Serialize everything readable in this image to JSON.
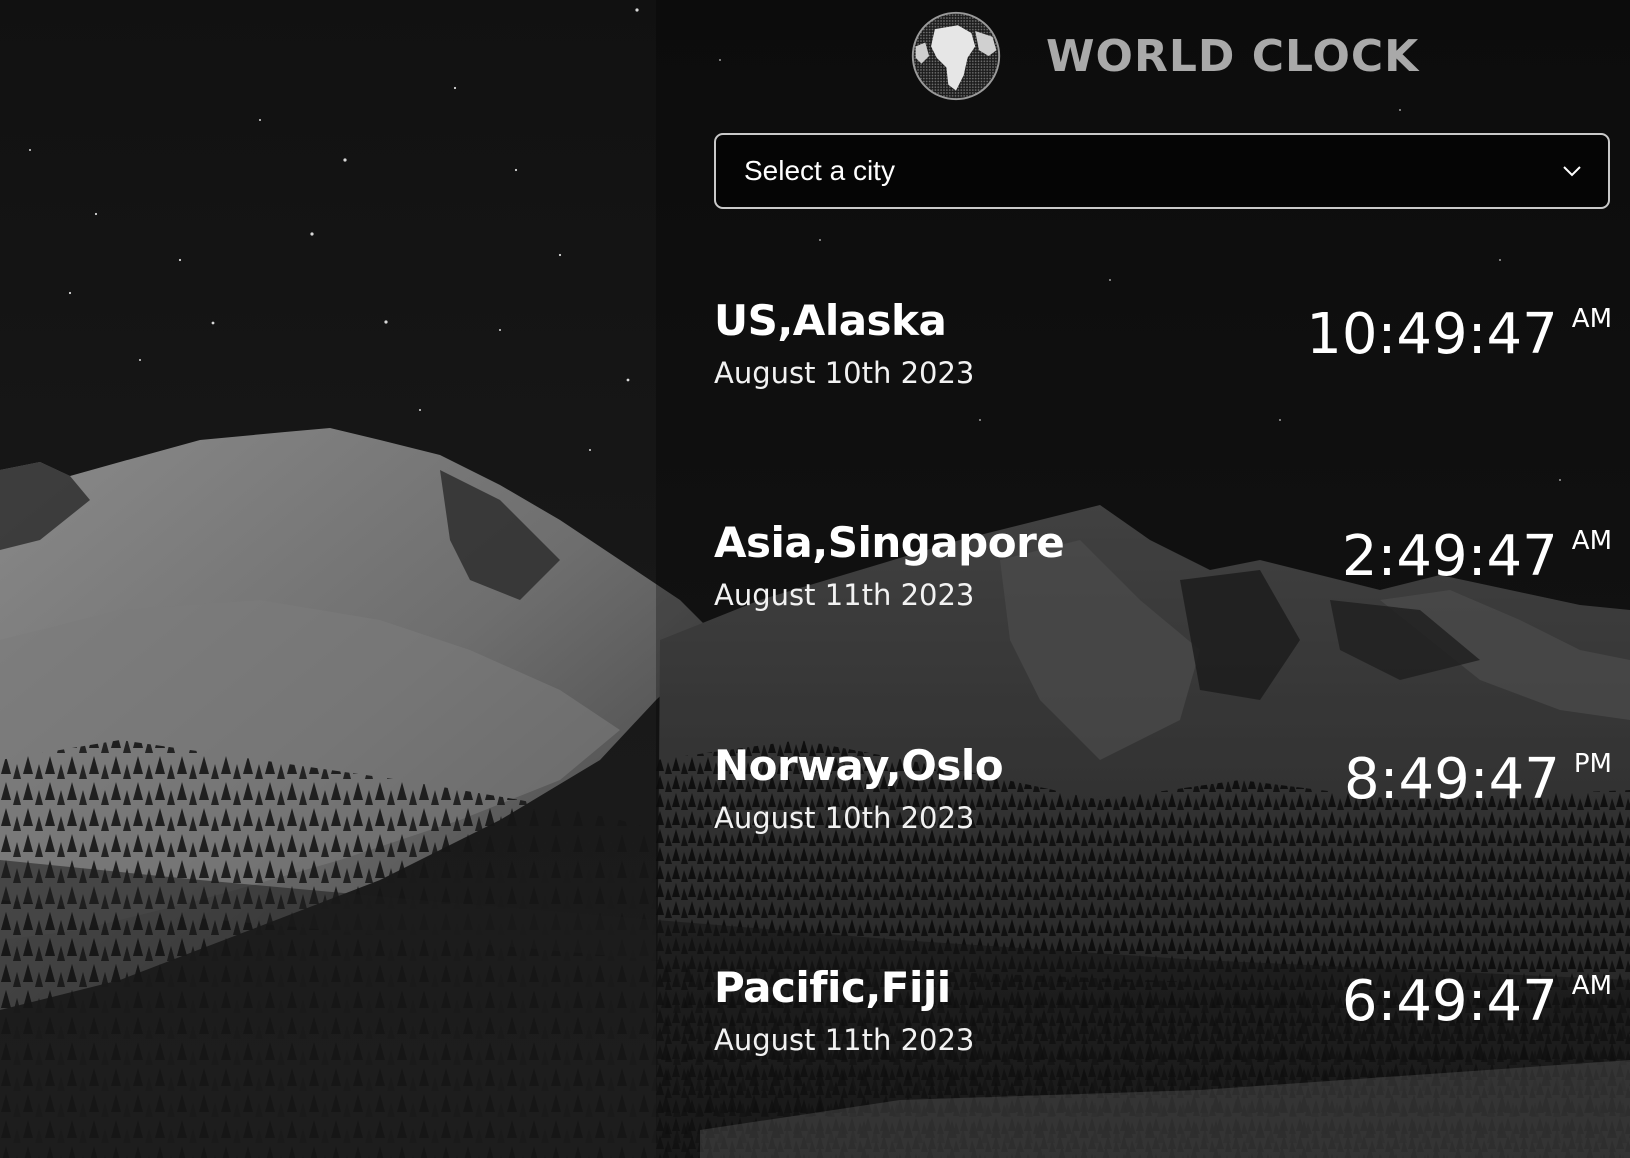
{
  "app": {
    "title": "WORLD CLOCK",
    "logo_icon": "globe-icon"
  },
  "city_select": {
    "selected": "Select a city",
    "icon": "chevron-down-icon"
  },
  "cities": [
    {
      "name": "US,Alaska",
      "date": "August 10th 2023",
      "time": "10:49:47",
      "ampm": "AM"
    },
    {
      "name": "Asia,Singapore",
      "date": "August 11th 2023",
      "time": "2:49:47",
      "ampm": "AM"
    },
    {
      "name": "Norway,Oslo",
      "date": "August 10th 2023",
      "time": "8:49:47",
      "ampm": "PM"
    },
    {
      "name": "Pacific,Fiji",
      "date": "August 11th 2023",
      "time": "6:49:47",
      "ampm": "AM"
    }
  ],
  "colors": {
    "title": "#a9a9a9",
    "text": "#ffffff",
    "select_border": "#c9c9c9"
  }
}
